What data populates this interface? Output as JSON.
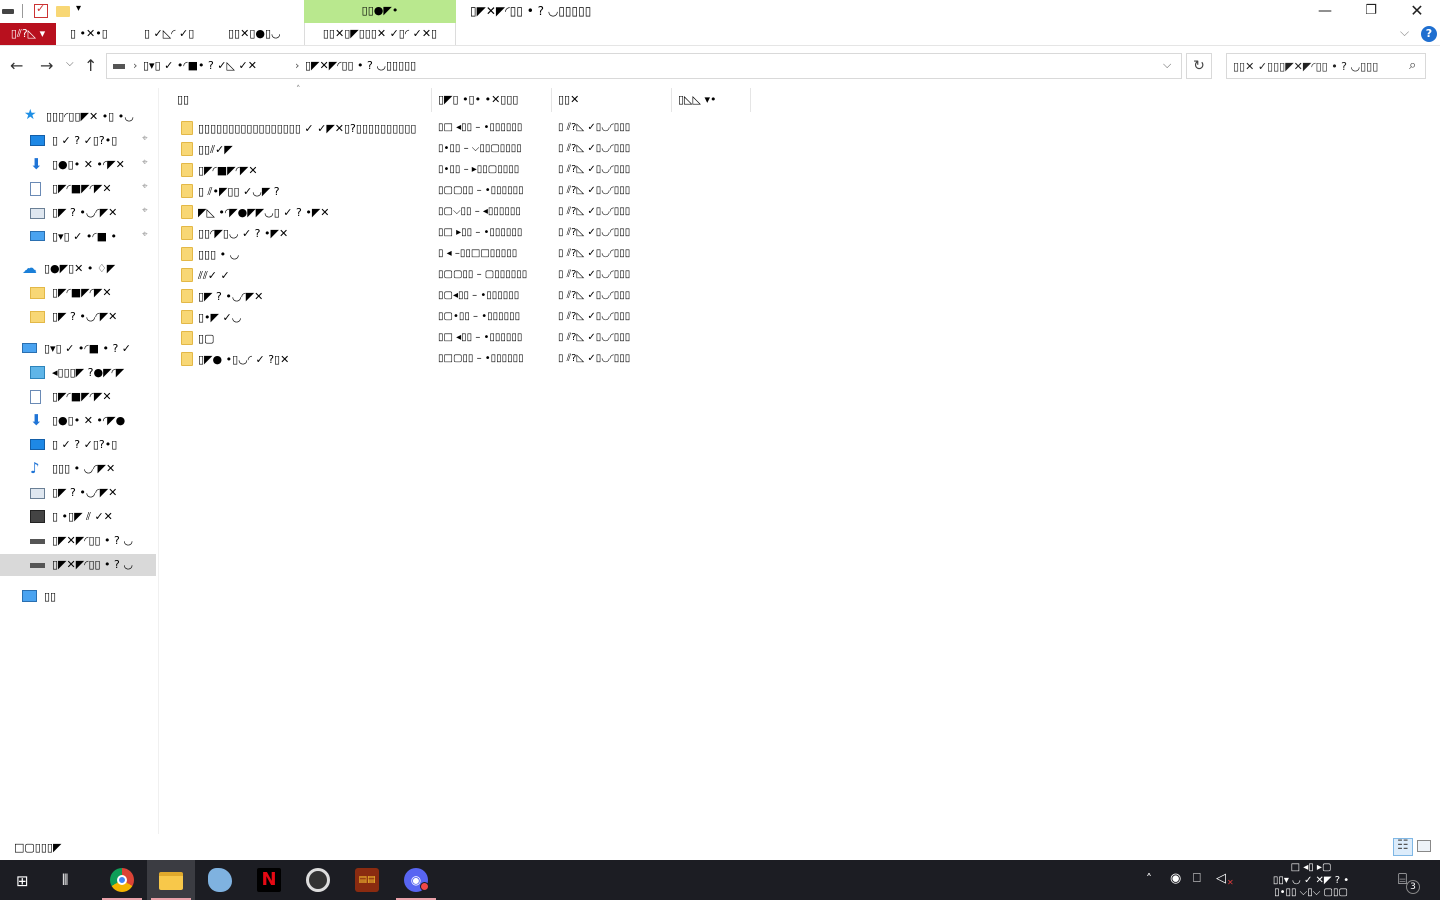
{
  "window": {
    "title": "▯◤✕◤◜▯▯ • ? ◡▯▯▯▯▯",
    "context_group_label": "▯▯●◤•",
    "minimize_glyph": "—",
    "maximize_glyph": "❐",
    "close_glyph": "✕"
  },
  "quick_access_toolbar": {
    "dropdown_glyph": "▾"
  },
  "ribbon": {
    "tabs": [
      {
        "label": "▯⫽?◺ ▾"
      },
      {
        "label": "▯ •✕•▯"
      },
      {
        "label": "▯ ✓◺◜ ✓▯"
      },
      {
        "label": "▯▯✕▯●▯◡"
      },
      {
        "label": "▯▯✕▯◤▯▯▯✕ ✓▯◜ ✓✕▯"
      }
    ],
    "expand_glyph": "⌵",
    "help_glyph": "?"
  },
  "navigation": {
    "back_glyph": "←",
    "forward_glyph": "→",
    "recent_glyph": "⌵",
    "up_glyph": "↑",
    "address": {
      "separator": "›",
      "crumbs": [
        "▯▾▯ ✓ •◜■• ? ✓◺ ✓✕",
        "▯◤✕◤◜▯▯ • ? ◡▯▯▯▯▯"
      ],
      "dropdown_glyph": "⌵"
    },
    "refresh_glyph": "↻",
    "search": {
      "placeholder": "▯▯✕ ✓▯▯▯◤✕◤◜▯▯ • ? ◡▯▯▯",
      "icon_glyph": "⌕"
    }
  },
  "sidebar": {
    "pin_glyph": "⌖",
    "items": [
      {
        "label": "▯▯▯◜▯▯◤✕ •▯ •◡",
        "icon": "star-icon",
        "glyph": "★",
        "pinned": false
      },
      {
        "label": "▯ ✓ ? ✓▯?•▯",
        "icon": "desktop-icon",
        "glyph": "",
        "pinned": true
      },
      {
        "label": "▯●▯• ✕ •◜◤✕",
        "icon": "download-icon",
        "glyph": "⬇",
        "pinned": true
      },
      {
        "label": "▯◤◜■◤◜◤✕",
        "icon": "document-icon",
        "glyph": "",
        "pinned": true
      },
      {
        "label": "▯◤ ? •◡◜◤✕",
        "icon": "picture-icon",
        "glyph": "",
        "pinned": true
      },
      {
        "label": "▯▾▯ ✓ •◜■ •",
        "icon": "computer-icon",
        "glyph": "",
        "pinned": true
      },
      {
        "label": "▯●◤▯✕ • ♢◤",
        "icon": "cloud-icon",
        "glyph": "☁",
        "pinned": false
      },
      {
        "label": "▯◤◜■◤◜◤✕",
        "icon": "folder-icon",
        "glyph": "",
        "pinned": false
      },
      {
        "label": "▯◤ ? •◡◜◤✕",
        "icon": "folder-icon",
        "glyph": "",
        "pinned": false
      },
      {
        "label": "▯▾▯ ✓ •◜■ • ? ✓",
        "icon": "computer-icon",
        "glyph": "",
        "pinned": false
      },
      {
        "label": "◂▯▯▯◤ ?●◤◜◤",
        "icon": "3d-objects-icon",
        "glyph": "",
        "pinned": false
      },
      {
        "label": "▯◤◜■◤◜◤✕",
        "icon": "document-icon",
        "glyph": "",
        "pinned": false
      },
      {
        "label": "▯●▯• ✕ •◜◤●",
        "icon": "download-icon",
        "glyph": "⬇",
        "pinned": false
      },
      {
        "label": "▯ ✓ ? ✓▯?•▯",
        "icon": "desktop-icon",
        "glyph": "",
        "pinned": false
      },
      {
        "label": "▯▯▯ • ◡◜◤✕",
        "icon": "music-icon",
        "glyph": "♪",
        "pinned": false
      },
      {
        "label": "▯◤ ? •◡◜◤✕",
        "icon": "picture-icon",
        "glyph": "",
        "pinned": false
      },
      {
        "label": "▯ •▯◤ ⫽ ✓✕",
        "icon": "video-icon",
        "glyph": "",
        "pinned": false
      },
      {
        "label": "▯◤✕◤◜▯▯ • ? ◡",
        "icon": "drive-icon",
        "glyph": "",
        "pinned": false
      },
      {
        "label": "▯◤✕◤◜▯▯ • ? ◡",
        "icon": "drive-icon",
        "glyph": "",
        "pinned": false,
        "selected": true
      },
      {
        "label": "▯▯",
        "icon": "network-icon",
        "glyph": "",
        "pinned": false
      }
    ]
  },
  "file_list": {
    "sort_glyph": "˄",
    "columns": [
      {
        "label": "▯▯"
      },
      {
        "label": "▯◤▯ •▯• •✕▯▯▯"
      },
      {
        "label": "▯▯✕"
      },
      {
        "label": "▯◺◺ ▾•"
      }
    ],
    "rows": [
      {
        "name": "▯▯▯▯▯▯▯▯▯▯▯▯▯▯▯▯▯ ✓ ✓◤✕▯?▯▯▯▯▯▯▯▯▯▯",
        "date": "▯□ ◂▯▯ – •▯▯▯▯▯▯",
        "type": "▯ ⫽?◺ ✓▯◡◜▯▯▯"
      },
      {
        "name": "▯▯⫽✓◤",
        "date": "▯•▯▯ – ⌵▯▯▢▯▯▯▯",
        "type": "▯ ⫽?◺ ✓▯◡◜▯▯▯"
      },
      {
        "name": "▯◤◜■◤◜◤✕",
        "date": "▯•▯▯ – ▸▯▯▢▯▯▯▯",
        "type": "▯ ⫽?◺ ✓▯◡◜▯▯▯"
      },
      {
        "name": "▯ ⫽•◤▯▯ ✓◡◤ ?",
        "date": "▯▢▢▯▯ – •▯▯▯▯▯▯",
        "type": "▯ ⫽?◺ ✓▯◡◜▯▯▯"
      },
      {
        "name": "◤◺ •◜◤●◤◤◡▯ ✓ ? •◤✕",
        "date": "▯▢⌵▯▯ – ◂▯▯▯▯▯▯",
        "type": "▯ ⫽?◺ ✓▯◡◜▯▯▯"
      },
      {
        "name": "▯▯◜◤▯◡ ✓ ? •◤✕",
        "date": "▯□ ▸▯▯ – •▯▯▯▯▯▯",
        "type": "▯ ⫽?◺ ✓▯◡◜▯▯▯"
      },
      {
        "name": "▯▯▯ • ◡",
        "date": "▯ ◂ –▯▯□□▯▯▯▯▯",
        "type": "▯ ⫽?◺ ✓▯◡◜▯▯▯"
      },
      {
        "name": "⫽⫽✓ ✓",
        "date": "▯▢▢▯▯ – ▢▯▯▯▯▯▯",
        "type": "▯ ⫽?◺ ✓▯◡◜▯▯▯"
      },
      {
        "name": "▯◤ ? •◡◜◤✕",
        "date": "▯▢◂▯▯ – •▯▯▯▯▯▯",
        "type": "▯ ⫽?◺ ✓▯◡◜▯▯▯"
      },
      {
        "name": "▯•◤ ✓◡",
        "date": "▯▢•▯▯ – •▯▯▯▯▯▯",
        "type": "▯ ⫽?◺ ✓▯◡◜▯▯▯"
      },
      {
        "name": "▯▢",
        "date": "▯□ ◂▯▯ – •▯▯▯▯▯▯",
        "type": "▯ ⫽?◺ ✓▯◡◜▯▯▯"
      },
      {
        "name": "▯◤● •▯◡◜ ✓ ?▯✕",
        "date": "▯□▢▯▯ – •▯▯▯▯▯▯",
        "type": "▯ ⫽?◺ ✓▯◡◜▯▯▯"
      }
    ]
  },
  "statusbar": {
    "item_count": "□▢▯▯▯◤"
  },
  "taskbar": {
    "start_glyph": "⊞",
    "taskview_glyph": "⫴",
    "netflix_glyph": "N",
    "game_glyph": "▤▤",
    "discord_glyph": "◉",
    "tray": {
      "chevron_glyph": "˄",
      "discord_glyph": "◉",
      "network_glyph": "⎕",
      "volume_glyph": "◁",
      "volume_mute_glyph": "✕",
      "time": "□ ◂▯ ▸▢",
      "date": "▯▯▾ ◡ ✓ ✕◤ ? •",
      "date2": "▯•▯▯ ⌵▯⌵ ▢▯▢",
      "notify_glyph": "⌸",
      "notify_count": "3"
    }
  },
  "colors": {
    "file_tab": "#b8101e",
    "context_tab": "#b9e88e",
    "folder": "#f8d775",
    "taskbar": "#1c1d23",
    "accent": "#1f6fd0"
  }
}
